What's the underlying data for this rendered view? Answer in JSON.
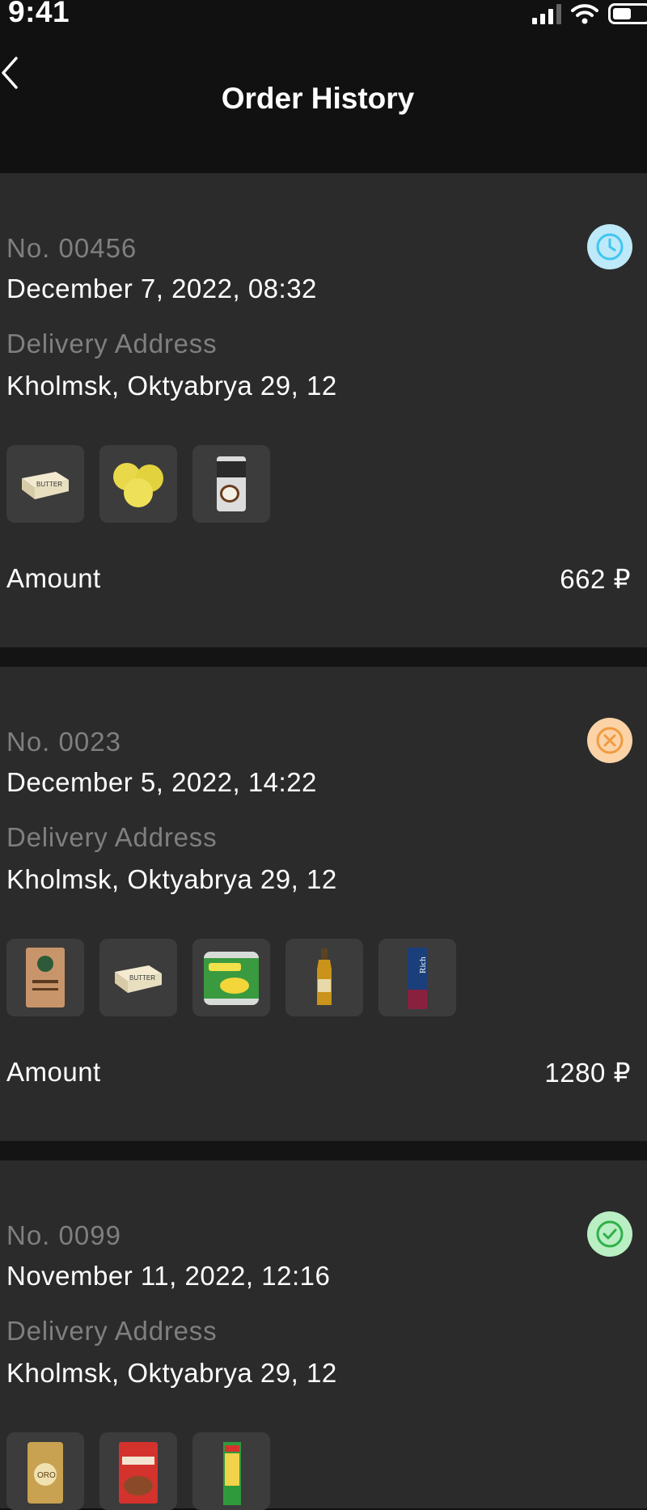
{
  "status_bar": {
    "time": "9:41"
  },
  "header": {
    "title": "Order History"
  },
  "orders": [
    {
      "number": "No. 00456",
      "date": "December 7, 2022, 08:32",
      "address_label": "Delivery Address",
      "address": "Kholmsk, Oktyabrya 29, 12",
      "status_icon": "clock-icon",
      "status_color": "#3fc6f0",
      "status_bg": "#bde9f8",
      "products": [
        "butter",
        "yellow apples",
        "coconut milk can"
      ],
      "amount_label": "Amount",
      "amount": "662 ₽"
    },
    {
      "number": "No. 0023",
      "date": "December 5, 2022, 14:22",
      "address_label": "Delivery Address",
      "address": "Kholmsk, Oktyabrya 29, 12",
      "status_icon": "cancel-icon",
      "status_color": "#f09a40",
      "status_bg": "#fbd3a6",
      "products": [
        "flour bag",
        "butter",
        "corn can",
        "oil bottle",
        "juice carton"
      ],
      "amount_label": "Amount",
      "amount": "1280 ₽"
    },
    {
      "number": "No. 0099",
      "date": "November 11, 2022, 12:16",
      "address_label": "Delivery Address",
      "address": "Kholmsk, Oktyabrya 29, 12",
      "status_icon": "check-icon",
      "status_color": "#2fb04a",
      "status_bg": "#b9efc3",
      "products": [
        "coffee bag",
        "buckwheat pack",
        "spaghetti pack"
      ]
    }
  ]
}
